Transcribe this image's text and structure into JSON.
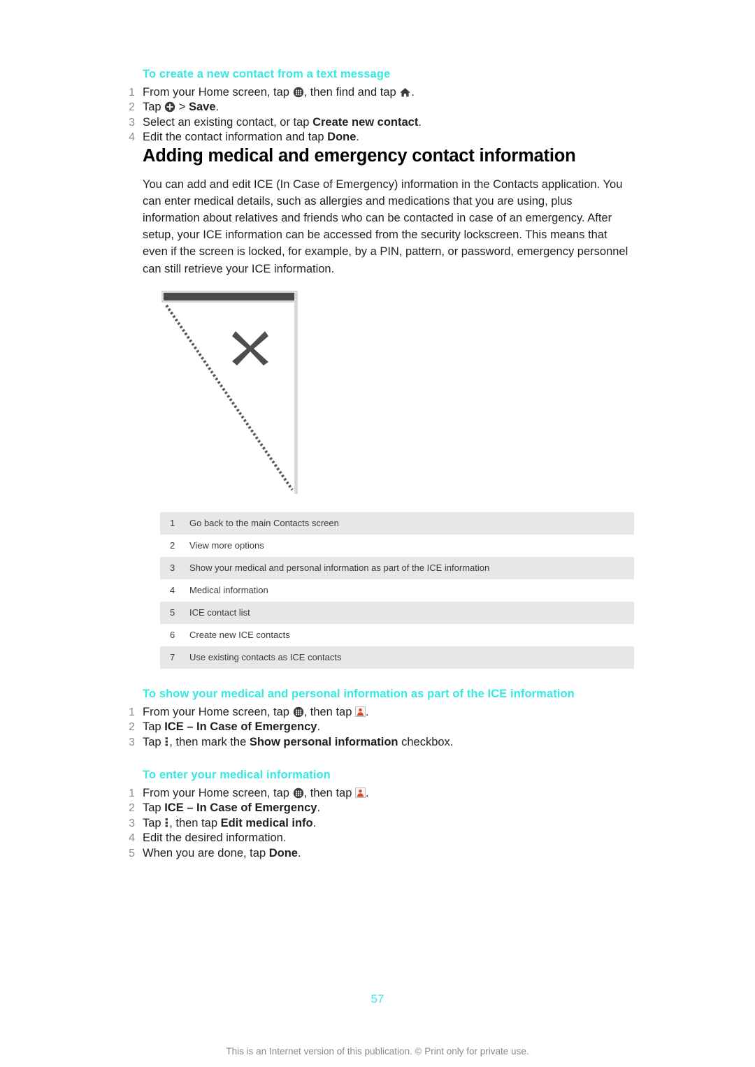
{
  "document": {
    "page_number": "57",
    "footer_note": "This is an Internet version of this publication. © Print only for private use.",
    "accent_color": "#36e9e1",
    "shaded_row_color": "#e7e7e7",
    "step_number_color": "#8d8d8d"
  },
  "sections": {
    "create_contact_from_sms": {
      "heading": "To create a new contact from a text message",
      "steps": [
        {
          "num": "1",
          "parts": [
            {
              "type": "text",
              "value": "From your Home screen, tap "
            },
            {
              "type": "icon",
              "value": "app-drawer-icon"
            },
            {
              "type": "text",
              "value": ", then find and tap "
            },
            {
              "type": "icon",
              "value": "home-icon"
            },
            {
              "type": "text",
              "value": "."
            }
          ]
        },
        {
          "num": "2",
          "parts": [
            {
              "type": "text",
              "value": "Tap "
            },
            {
              "type": "icon",
              "value": "plus-circle-icon"
            },
            {
              "type": "text",
              "value": " > "
            },
            {
              "type": "bold",
              "value": "Save"
            },
            {
              "type": "text",
              "value": "."
            }
          ]
        },
        {
          "num": "3",
          "parts": [
            {
              "type": "text",
              "value": "Select an existing contact, or tap "
            },
            {
              "type": "bold",
              "value": "Create new contact"
            },
            {
              "type": "text",
              "value": "."
            }
          ]
        },
        {
          "num": "4",
          "parts": [
            {
              "type": "text",
              "value": "Edit the contact information and tap "
            },
            {
              "type": "bold",
              "value": "Done"
            },
            {
              "type": "text",
              "value": "."
            }
          ]
        }
      ]
    },
    "adding_medical": {
      "heading": "Adding medical and emergency contact information",
      "body": "You can add and edit ICE (In Case of Emergency) information in the Contacts application. You can enter medical details, such as allergies and medications that you are using, plus information about relatives and friends who can be contacted in case of an emergency. After setup, your ICE information can be accessed from the security lockscreen. This means that even if the screen is locked, for example, by a PIN, pattern, or password, emergency personnel can still retrieve your ICE information.",
      "figure": {
        "name": "broken-image-placeholder",
        "alt": "missing screenshot placeholder"
      },
      "legend": [
        {
          "num": "1",
          "desc": "Go back to the main Contacts screen"
        },
        {
          "num": "2",
          "desc": "View more options"
        },
        {
          "num": "3",
          "desc": "Show your medical and personal information as part of the ICE information"
        },
        {
          "num": "4",
          "desc": "Medical information"
        },
        {
          "num": "5",
          "desc": "ICE contact list"
        },
        {
          "num": "6",
          "desc": "Create new ICE contacts"
        },
        {
          "num": "7",
          "desc": "Use existing contacts as ICE contacts"
        }
      ]
    },
    "show_medical_info": {
      "heading": "To show your medical and personal information as part of the ICE information",
      "steps": [
        {
          "num": "1",
          "parts": [
            {
              "type": "text",
              "value": "From your Home screen, tap "
            },
            {
              "type": "icon",
              "value": "app-drawer-icon"
            },
            {
              "type": "text",
              "value": ", then tap "
            },
            {
              "type": "icon",
              "value": "contacts-icon"
            },
            {
              "type": "text",
              "value": "."
            }
          ]
        },
        {
          "num": "2",
          "parts": [
            {
              "type": "text",
              "value": "Tap "
            },
            {
              "type": "bold",
              "value": "ICE – In Case of Emergency"
            },
            {
              "type": "text",
              "value": "."
            }
          ]
        },
        {
          "num": "3",
          "parts": [
            {
              "type": "text",
              "value": "Tap "
            },
            {
              "type": "icon",
              "value": "overflow-menu-icon"
            },
            {
              "type": "text",
              "value": ", then mark the "
            },
            {
              "type": "bold",
              "value": "Show personal information"
            },
            {
              "type": "text",
              "value": " checkbox."
            }
          ]
        }
      ]
    },
    "enter_medical_info": {
      "heading": "To enter your medical information",
      "steps": [
        {
          "num": "1",
          "parts": [
            {
              "type": "text",
              "value": "From your Home screen, tap "
            },
            {
              "type": "icon",
              "value": "app-drawer-icon"
            },
            {
              "type": "text",
              "value": ", then tap "
            },
            {
              "type": "icon",
              "value": "contacts-icon"
            },
            {
              "type": "text",
              "value": "."
            }
          ]
        },
        {
          "num": "2",
          "parts": [
            {
              "type": "text",
              "value": "Tap "
            },
            {
              "type": "bold",
              "value": "ICE – In Case of Emergency"
            },
            {
              "type": "text",
              "value": "."
            }
          ]
        },
        {
          "num": "3",
          "parts": [
            {
              "type": "text",
              "value": "Tap "
            },
            {
              "type": "icon",
              "value": "overflow-menu-icon"
            },
            {
              "type": "text",
              "value": ", then tap "
            },
            {
              "type": "bold",
              "value": "Edit medical info"
            },
            {
              "type": "text",
              "value": "."
            }
          ]
        },
        {
          "num": "4",
          "parts": [
            {
              "type": "text",
              "value": "Edit the desired information."
            }
          ]
        },
        {
          "num": "5",
          "parts": [
            {
              "type": "text",
              "value": "When you are done, tap "
            },
            {
              "type": "bold",
              "value": "Done"
            },
            {
              "type": "text",
              "value": "."
            }
          ]
        }
      ]
    }
  }
}
